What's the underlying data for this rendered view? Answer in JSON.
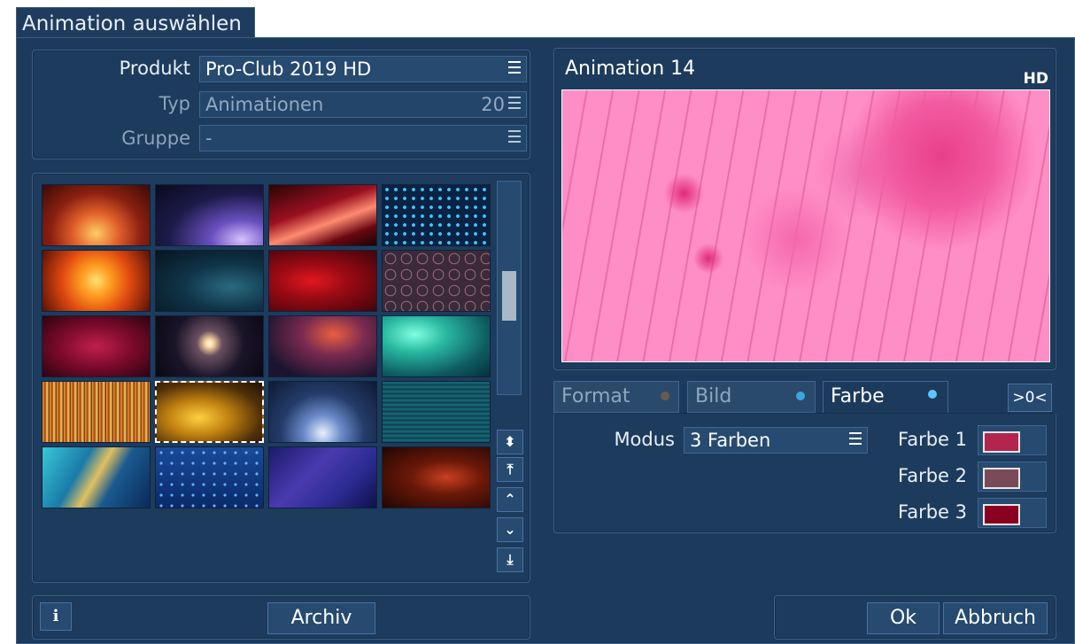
{
  "window": {
    "title": "Animation auswählen"
  },
  "product": {
    "produkt_label": "Produkt",
    "produkt_value": "Pro-Club 2019 HD",
    "typ_label": "Typ",
    "typ_value": "Animationen",
    "typ_count": "20",
    "gruppe_label": "Gruppe",
    "gruppe_value": "-"
  },
  "grid": {
    "thumbnails": [
      {
        "name": "orange-rays",
        "bg": "radial-gradient(ellipse at 50% 80%, #ffcc66 0%, #e2602a 30%, #8a2010 60%, #3a0a08 100%)"
      },
      {
        "name": "purple-particles",
        "bg": "radial-gradient(ellipse at 80% 90%, #d8c0ff 0%, #6a50c0 25%, #1c1a48 60%, #0a0a1e 100%)"
      },
      {
        "name": "red-streaks",
        "bg": "linear-gradient(160deg, #2a0406 0%, #9a1020 40%, #ff8a70 60%, #6a0810 80%, #1a0204 100%)"
      },
      {
        "name": "blue-dots",
        "bg": "radial-gradient(circle, #3ac8ff 25%, transparent 30%) 0 0/10px 10px, #0a2244"
      },
      {
        "name": "orange-burst",
        "bg": "radial-gradient(circle at 50% 50%, #ffe070 0%, #ff9a20 25%, #e04a10 55%, #5a1006 100%)"
      },
      {
        "name": "teal-particles",
        "bg": "radial-gradient(ellipse at 70% 60%, #2a6a80 0%, #103448 45%, #06141e 100%)"
      },
      {
        "name": "red-bokeh",
        "bg": "radial-gradient(ellipse at 40% 50%, #e01820 0%, #9a0a14 40%, #40040a 100%)"
      },
      {
        "name": "bubbles",
        "bg": "radial-gradient(circle, transparent 40%, #c08080 45%, transparent 52%) 0 0/18px 18px, #3a2a3a"
      },
      {
        "name": "crimson-sparkle",
        "bg": "radial-gradient(ellipse at 50% 50%, #c0204a 0%, #7a0a2a 50%, #2a0410 100%)"
      },
      {
        "name": "lens-flare",
        "bg": "radial-gradient(circle at 50% 45%, #ffffff 0%, #ffd8a0 6%, #6a5060 20%, #1a1428 55%, #0a0814 100%)"
      },
      {
        "name": "gold-dust",
        "bg": "radial-gradient(ellipse at 60% 30%, #e86040 0%, #7a2a50 35%, #1a1430 80%)"
      },
      {
        "name": "teal-bokeh",
        "bg": "radial-gradient(ellipse at 30% 30%, #80ffe0 0%, #28b8a0 30%, #0e5a60 70%, #06303a 100%)"
      },
      {
        "name": "golden-rain",
        "bg": "repeating-linear-gradient(90deg, #f0a030 0px, #a04010 3px, #ffd060 5px, #602008 8px)"
      },
      {
        "name": "golden-bokeh",
        "bg": "radial-gradient(ellipse at 40% 60%, #ffd040 0%, #c08010 35%, #503008 70%, #201004 100%)"
      },
      {
        "name": "blue-light-rays",
        "bg": "radial-gradient(ellipse at 50% 85%, #e8f0ff 0%, #6a8ac8 25%, #243c6a 55%, #0e1a34 100%)"
      },
      {
        "name": "teal-lines",
        "bg": "repeating-linear-gradient(0deg, #0e4a5a 0px, #1a6a7a 2px, #0a3a48 5px)"
      },
      {
        "name": "cyan-wave",
        "bg": "linear-gradient(120deg, #38c8d8 0%, #1a7aa8 35%, #e0c060 50%, #1a5a90 65%, #0a2a5a 100%)"
      },
      {
        "name": "blue-grid",
        "bg": "radial-gradient(circle, #6ab0ff 15%, transparent 22%) 0 0/12px 12px, linear-gradient(180deg, #1a4a9a, #0a2a6a)"
      },
      {
        "name": "indigo-shapes",
        "bg": "linear-gradient(135deg, #1a1a6a 0%, #4a3ab0 40%, #2a2a90 70%, #10104a 100%)"
      },
      {
        "name": "red-fibers",
        "bg": "radial-gradient(ellipse at 60% 50%, #c84020 0%, #6a1808 40%, #200604 100%)"
      }
    ],
    "selected_index": 13
  },
  "scrollbar": {
    "position_fraction": 0.55
  },
  "preview": {
    "title": "Animation 14",
    "badge": "HD"
  },
  "tabs": {
    "format": "Format",
    "bild": "Bild",
    "farbe": "Farbe",
    "reset": ">0<"
  },
  "farbe": {
    "modus_label": "Modus",
    "modus_value": "3 Farben",
    "colors": [
      {
        "label": "Farbe 1",
        "color": "#b3244e"
      },
      {
        "label": "Farbe 2",
        "color": "#7a4a58"
      },
      {
        "label": "Farbe 3",
        "color": "#8a0020"
      }
    ]
  },
  "buttons": {
    "info": "i",
    "archiv": "Archiv",
    "ok": "Ok",
    "abbruch": "Abbruch"
  }
}
